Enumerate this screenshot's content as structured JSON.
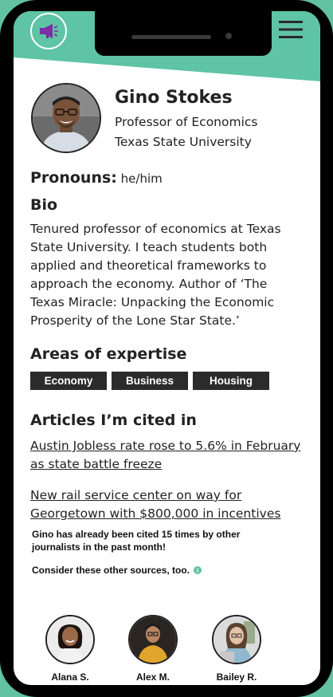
{
  "profile": {
    "name": "Gino Stokes",
    "title": "Professor of Economics",
    "university": "Texas State University",
    "pronouns_label": "Pronouns:",
    "pronouns": "he/him"
  },
  "bio": {
    "heading": "Bio",
    "text": "Tenured professor of economics at Texas State University. I teach students both applied and theoretical frameworks to approach the economy. Author of ‘The Texas Miracle: Unpacking the Economic Prosperity of the Lone Star State.’"
  },
  "expertise": {
    "heading": "Areas of expertise",
    "tags": [
      "Economy",
      "Business",
      "Housing"
    ]
  },
  "articles": {
    "heading": "Articles I’m cited in",
    "items": [
      "Austin Jobless rate rose to 5.6% in February as state battle freeze",
      "New rail service center on way for Georgetown with $800,000 in incentives"
    ]
  },
  "notice": {
    "citations": "Gino has already been cited 15 times by other journalists in the past month!",
    "consider": "Consider these other sources, too.",
    "info_icon": "i"
  },
  "sources": [
    {
      "name": "Alana S."
    },
    {
      "name": "Alex M."
    },
    {
      "name": "Bailey R."
    }
  ],
  "colors": {
    "accent": "#5ec4a3",
    "megaphone": "#7b2fa8",
    "tag_bg": "#2b2b2b"
  },
  "icons": {
    "header_left": "megaphone-icon",
    "header_right": "hamburger-menu-icon",
    "info": "info-icon"
  }
}
